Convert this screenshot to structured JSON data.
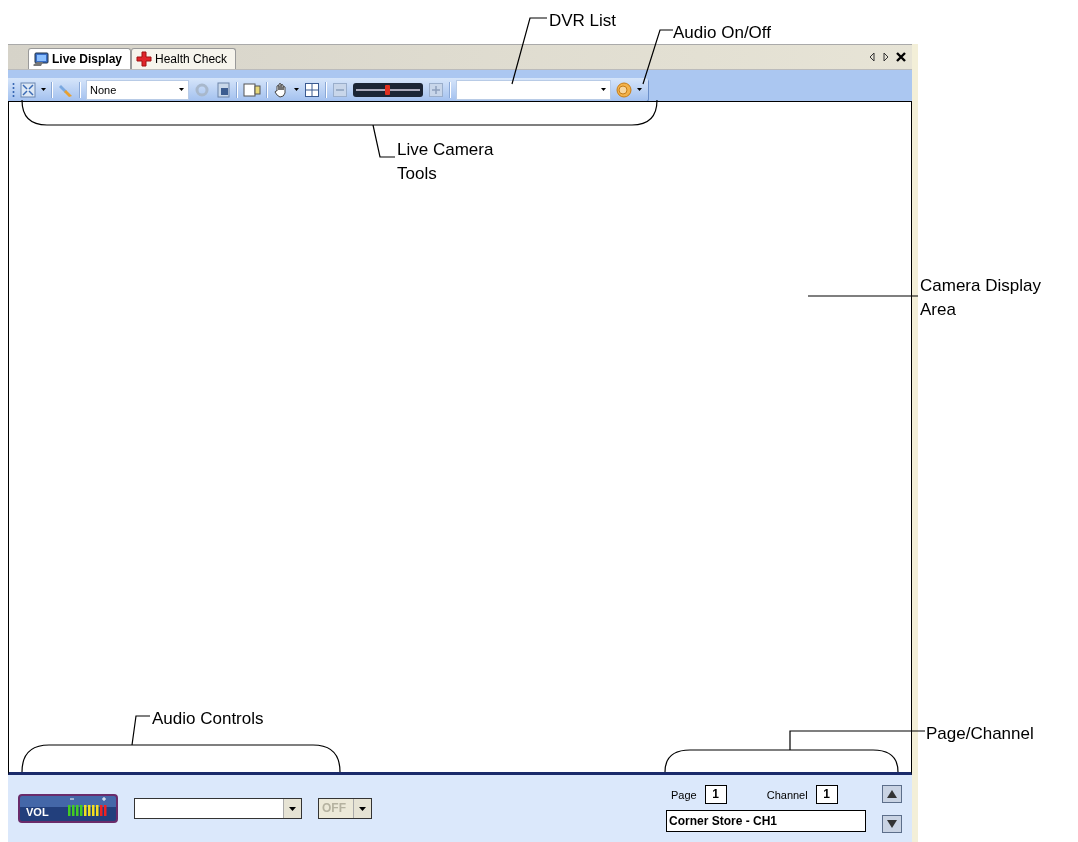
{
  "tabs": [
    {
      "label": "Live Display",
      "selected": true
    },
    {
      "label": "Health Check",
      "selected": false
    }
  ],
  "toolbar": {
    "camera_select": {
      "value": "None"
    },
    "zoom_slider": {
      "level": 0.5
    }
  },
  "audio": {
    "volume_label": "VOL",
    "mode_select": {
      "value": "OFF",
      "disabled": true
    }
  },
  "navigation": {
    "page_label": "Page",
    "page": "1",
    "channel_label": "Channel",
    "channel": "1",
    "camera_name": "Corner Store - CH1"
  },
  "callouts": [
    {
      "text": "DVR List"
    },
    {
      "text": "Audio On/Off"
    },
    {
      "text": "Live Camera Tools"
    },
    {
      "text": "Camera Display Area"
    },
    {
      "text": "Audio Controls"
    },
    {
      "text": "Page/Channel"
    }
  ]
}
